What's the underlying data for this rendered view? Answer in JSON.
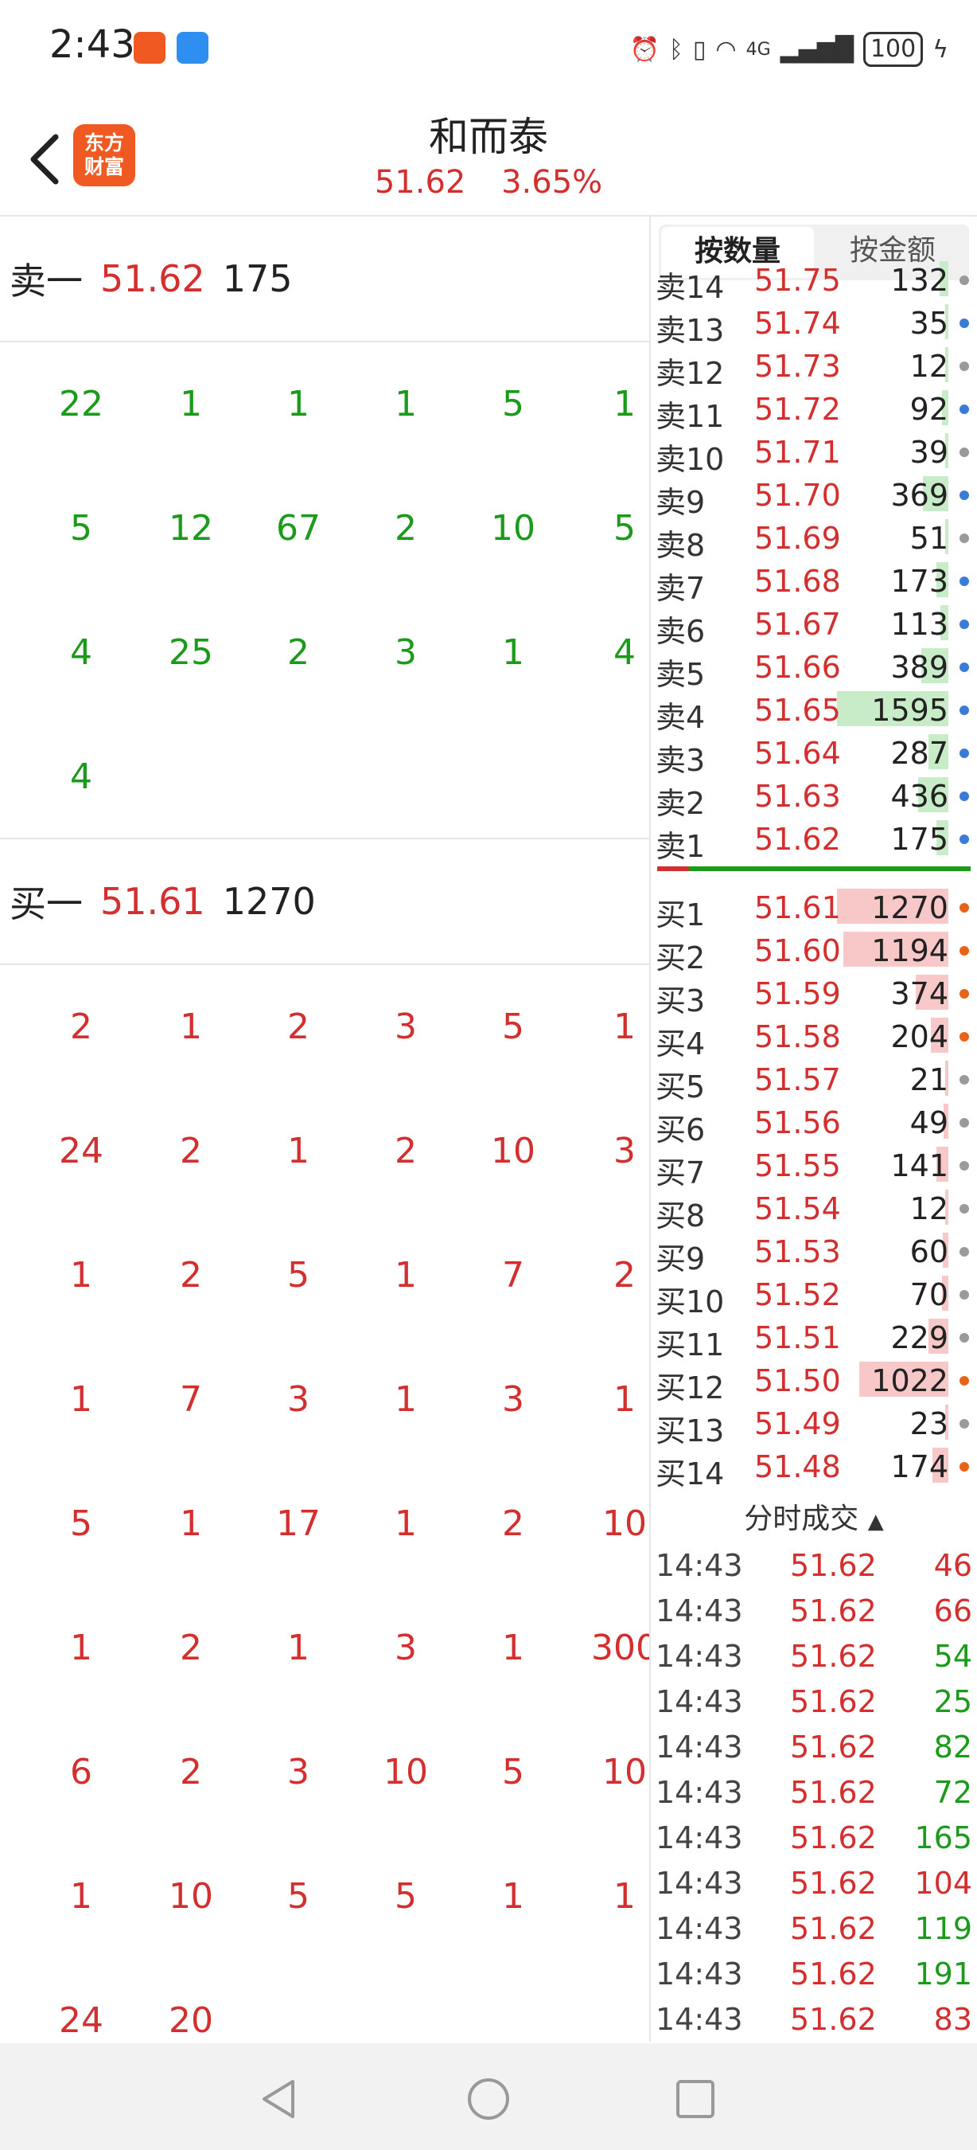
{
  "status_bar": {
    "time": "2:43",
    "battery": "100",
    "network": "4G"
  },
  "header": {
    "logo_line1": "东方",
    "logo_line2": "财富",
    "title": "和而泰",
    "price": "51.62",
    "change_pct": "3.65%"
  },
  "left": {
    "sell1": {
      "label": "卖一",
      "price": "51.62",
      "volume": "175"
    },
    "sell_queue": [
      [
        "22",
        "1",
        "1",
        "1",
        "5",
        "1"
      ],
      [
        "5",
        "12",
        "67",
        "2",
        "10",
        "5"
      ],
      [
        "4",
        "25",
        "2",
        "3",
        "1",
        "4"
      ],
      [
        "4"
      ]
    ],
    "buy1": {
      "label": "买一",
      "price": "51.61",
      "volume": "1270"
    },
    "buy_queue": [
      [
        "2",
        "1",
        "2",
        "3",
        "5",
        "1"
      ],
      [
        "24",
        "2",
        "1",
        "2",
        "10",
        "3"
      ],
      [
        "1",
        "2",
        "5",
        "1",
        "7",
        "2"
      ],
      [
        "1",
        "7",
        "3",
        "1",
        "3",
        "1"
      ],
      [
        "5",
        "1",
        "17",
        "1",
        "2",
        "10"
      ],
      [
        "1",
        "2",
        "1",
        "3",
        "1",
        "300"
      ],
      [
        "6",
        "2",
        "3",
        "10",
        "5",
        "10"
      ],
      [
        "1",
        "10",
        "5",
        "5",
        "1",
        "1"
      ],
      [
        "24",
        "20"
      ]
    ]
  },
  "right": {
    "tabs": [
      "按数量",
      "按金额"
    ],
    "asks": [
      {
        "label": "卖14",
        "price": "51.75",
        "volume": "132",
        "dot": "gray",
        "bar": 0.08
      },
      {
        "label": "卖13",
        "price": "51.74",
        "volume": "35",
        "dot": "blue",
        "bar": 0.02
      },
      {
        "label": "卖12",
        "price": "51.73",
        "volume": "12",
        "dot": "gray",
        "bar": 0.01
      },
      {
        "label": "卖11",
        "price": "51.72",
        "volume": "92",
        "dot": "blue",
        "bar": 0.06
      },
      {
        "label": "卖10",
        "price": "51.71",
        "volume": "39",
        "dot": "gray",
        "bar": 0.02
      },
      {
        "label": "卖9",
        "price": "51.70",
        "volume": "369",
        "dot": "blue",
        "bar": 0.23
      },
      {
        "label": "卖8",
        "price": "51.69",
        "volume": "51",
        "dot": "gray",
        "bar": 0.03
      },
      {
        "label": "卖7",
        "price": "51.68",
        "volume": "173",
        "dot": "blue",
        "bar": 0.11
      },
      {
        "label": "卖6",
        "price": "51.67",
        "volume": "113",
        "dot": "blue",
        "bar": 0.07
      },
      {
        "label": "卖5",
        "price": "51.66",
        "volume": "389",
        "dot": "blue",
        "bar": 0.24
      },
      {
        "label": "卖4",
        "price": "51.65",
        "volume": "1595",
        "dot": "blue",
        "bar": 1.0
      },
      {
        "label": "卖3",
        "price": "51.64",
        "volume": "287",
        "dot": "blue",
        "bar": 0.18
      },
      {
        "label": "卖2",
        "price": "51.63",
        "volume": "436",
        "dot": "blue",
        "bar": 0.27
      },
      {
        "label": "卖1",
        "price": "51.62",
        "volume": "175",
        "dot": "blue",
        "bar": 0.11
      }
    ],
    "bids": [
      {
        "label": "买1",
        "price": "51.61",
        "volume": "1270",
        "dot": "orange",
        "bar": 1.0
      },
      {
        "label": "买2",
        "price": "51.60",
        "volume": "1194",
        "dot": "orange",
        "bar": 0.94
      },
      {
        "label": "买3",
        "price": "51.59",
        "volume": "374",
        "dot": "orange",
        "bar": 0.29
      },
      {
        "label": "买4",
        "price": "51.58",
        "volume": "204",
        "dot": "orange",
        "bar": 0.16
      },
      {
        "label": "买5",
        "price": "51.57",
        "volume": "21",
        "dot": "gray",
        "bar": 0.02
      },
      {
        "label": "买6",
        "price": "51.56",
        "volume": "49",
        "dot": "gray",
        "bar": 0.04
      },
      {
        "label": "买7",
        "price": "51.55",
        "volume": "141",
        "dot": "gray",
        "bar": 0.11
      },
      {
        "label": "买8",
        "price": "51.54",
        "volume": "12",
        "dot": "gray",
        "bar": 0.01
      },
      {
        "label": "买9",
        "price": "51.53",
        "volume": "60",
        "dot": "gray",
        "bar": 0.05
      },
      {
        "label": "买10",
        "price": "51.52",
        "volume": "70",
        "dot": "gray",
        "bar": 0.06
      },
      {
        "label": "买11",
        "price": "51.51",
        "volume": "229",
        "dot": "gray",
        "bar": 0.18
      },
      {
        "label": "买12",
        "price": "51.50",
        "volume": "1022",
        "dot": "orange",
        "bar": 0.8
      },
      {
        "label": "买13",
        "price": "51.49",
        "volume": "23",
        "dot": "gray",
        "bar": 0.02
      },
      {
        "label": "买14",
        "price": "51.48",
        "volume": "174",
        "dot": "orange",
        "bar": 0.14
      }
    ],
    "trades_header": "分时成交",
    "trades": [
      {
        "time": "14:43",
        "price": "51.62",
        "volume": "46",
        "color": "red"
      },
      {
        "time": "14:43",
        "price": "51.62",
        "volume": "66",
        "color": "red"
      },
      {
        "time": "14:43",
        "price": "51.62",
        "volume": "54",
        "color": "green"
      },
      {
        "time": "14:43",
        "price": "51.62",
        "volume": "25",
        "color": "green"
      },
      {
        "time": "14:43",
        "price": "51.62",
        "volume": "82",
        "color": "green"
      },
      {
        "time": "14:43",
        "price": "51.62",
        "volume": "72",
        "color": "green"
      },
      {
        "time": "14:43",
        "price": "51.62",
        "volume": "165",
        "color": "green"
      },
      {
        "time": "14:43",
        "price": "51.62",
        "volume": "104",
        "color": "red"
      },
      {
        "time": "14:43",
        "price": "51.62",
        "volume": "119",
        "color": "green"
      },
      {
        "time": "14:43",
        "price": "51.62",
        "volume": "191",
        "color": "green"
      },
      {
        "time": "14:43",
        "price": "51.62",
        "volume": "83",
        "color": "red"
      }
    ]
  },
  "colors": {
    "up": "#d32f2f",
    "down": "#1b9a1b",
    "ask_bar": "#c8ecc8",
    "bid_bar": "#f8c8c8",
    "dot_blue": "#3a7bd5",
    "dot_gray": "#9a9a9a",
    "dot_orange": "#e8631a"
  }
}
